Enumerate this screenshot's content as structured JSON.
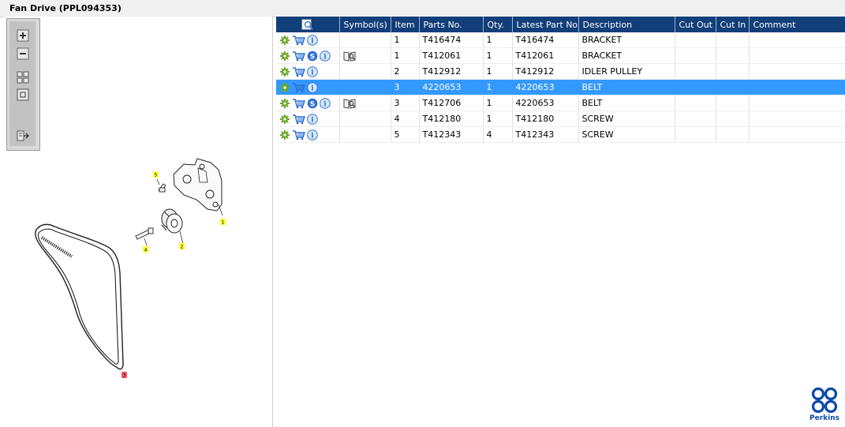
{
  "window": {
    "title": "Fan Drive (PPL094353)"
  },
  "toolbar": {
    "buttons": [
      {
        "name": "zoom-in-button",
        "icon": "zoom-in-icon"
      },
      {
        "name": "zoom-out-button",
        "icon": "zoom-out-icon"
      },
      {
        "name": "fit-all-button",
        "icon": "fit-all-icon"
      },
      {
        "name": "actual-size-button",
        "icon": "actual-size-icon"
      },
      {
        "name": "export-button",
        "icon": "export-icon"
      }
    ]
  },
  "diagram": {
    "callouts": [
      "5",
      "1",
      "4",
      "2",
      "3"
    ]
  },
  "table": {
    "headers": {
      "icon": "search-parts-icon",
      "symbols": "Symbol(s)",
      "item": "Item",
      "parts_no": "Parts No.",
      "qty": "Qty.",
      "latest_part_no": "Latest Part No.",
      "description": "Description",
      "cut_out": "Cut Out",
      "cut_in": "Cut In",
      "comment": "Comment"
    },
    "rows": [
      {
        "item": "1",
        "parts_no": "T416474",
        "qty": "1",
        "latest_part_no": "T416474",
        "description": "BRACKET",
        "cut_out": "",
        "cut_in": "",
        "comment": ""
      },
      {
        "item": "1",
        "parts_no": "T412061",
        "qty": "1",
        "latest_part_no": "T412061",
        "description": "BRACKET",
        "cut_out": "",
        "cut_in": "",
        "comment": ""
      },
      {
        "item": "2",
        "parts_no": "T412912",
        "qty": "1",
        "latest_part_no": "T412912",
        "description": "IDLER PULLEY",
        "cut_out": "",
        "cut_in": "",
        "comment": ""
      },
      {
        "item": "3",
        "parts_no": "4220653",
        "qty": "1",
        "latest_part_no": "4220653",
        "description": "BELT",
        "cut_out": "",
        "cut_in": "",
        "comment": ""
      },
      {
        "item": "3",
        "parts_no": "T412706",
        "qty": "1",
        "latest_part_no": "4220653",
        "description": "BELT",
        "cut_out": "",
        "cut_in": "",
        "comment": ""
      },
      {
        "item": "4",
        "parts_no": "T412180",
        "qty": "1",
        "latest_part_no": "T412180",
        "description": "SCREW",
        "cut_out": "",
        "cut_in": "",
        "comment": ""
      },
      {
        "item": "5",
        "parts_no": "T412343",
        "qty": "4",
        "latest_part_no": "T412343",
        "description": "SCREW",
        "cut_out": "",
        "cut_in": "",
        "comment": ""
      }
    ]
  },
  "logo": {
    "text": "Perkins"
  },
  "colors": {
    "header": "#123e7a",
    "selection": "#3399ff",
    "brand": "#0a4aa8"
  }
}
